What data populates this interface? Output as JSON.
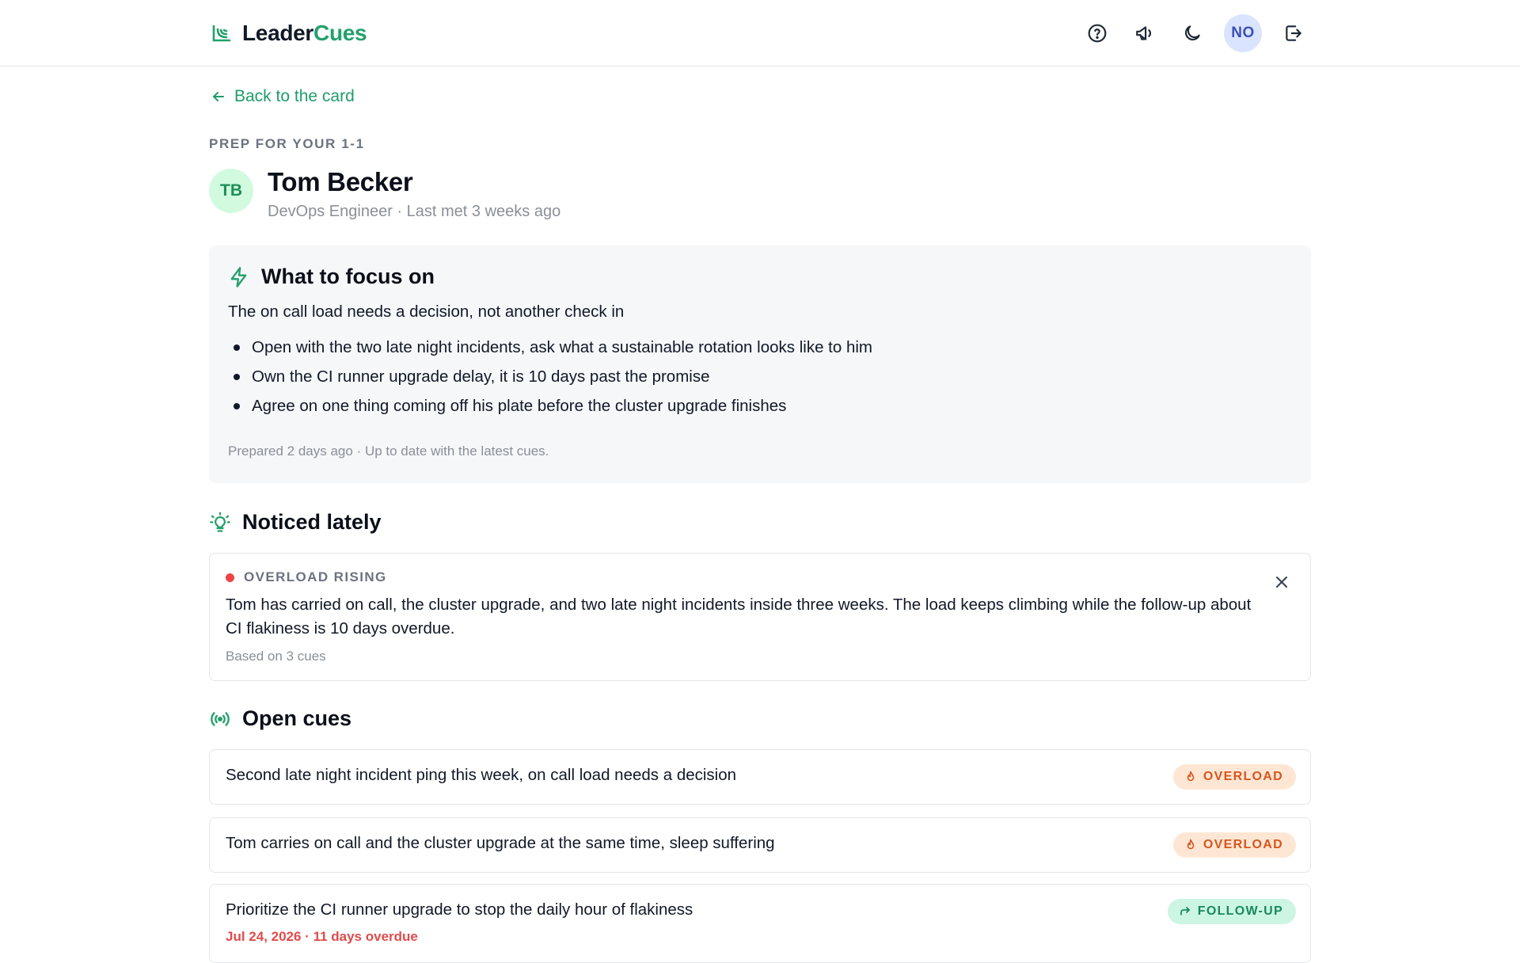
{
  "brand": {
    "name_part1": "Leader",
    "name_part2": "Cues",
    "accent": "#22a06b"
  },
  "header": {
    "icons": [
      "help-icon",
      "megaphone-icon",
      "moon-icon",
      "logout-icon"
    ],
    "user_initials": "NO"
  },
  "nav": {
    "back_label": "Back to the card"
  },
  "prep": {
    "eyebrow": "PREP FOR YOUR 1-1",
    "initials": "TB",
    "name": "Tom Becker",
    "subtitle": "DevOps Engineer · Last met 3 weeks ago"
  },
  "focus": {
    "title": "What to focus on",
    "lead": "The on call load needs a decision, not another check in",
    "points": [
      "Open with the two late night incidents, ask what a sustainable rotation looks like to him",
      "Own the CI runner upgrade delay, it is 10 days past the promise",
      "Agree on one thing coming off his plate before the cluster upgrade finishes"
    ],
    "footer": "Prepared 2 days ago · Up to date with the latest cues."
  },
  "noticed": {
    "title": "Noticed lately",
    "card": {
      "tag": "OVERLOAD RISING",
      "tag_color": "#ef4444",
      "body": "Tom has carried on call, the cluster upgrade, and two late night incidents inside three weeks. The load keeps climbing while the follow-up about CI flakiness is 10 days overdue.",
      "footer": "Based on 3 cues"
    }
  },
  "open_cues": {
    "title": "Open cues",
    "items": [
      {
        "text": "Second late night incident ping this week, on call load needs a decision",
        "badge": "OVERLOAD",
        "badge_type": "overload"
      },
      {
        "text": "Tom carries on call and the cluster upgrade at the same time, sleep suffering",
        "badge": "OVERLOAD",
        "badge_type": "overload"
      },
      {
        "text": "Prioritize the CI runner upgrade to stop the daily hour of flakiness",
        "badge": "FOLLOW-UP",
        "badge_type": "follow",
        "due": "Jul 24, 2026 · 11 days overdue"
      }
    ]
  }
}
